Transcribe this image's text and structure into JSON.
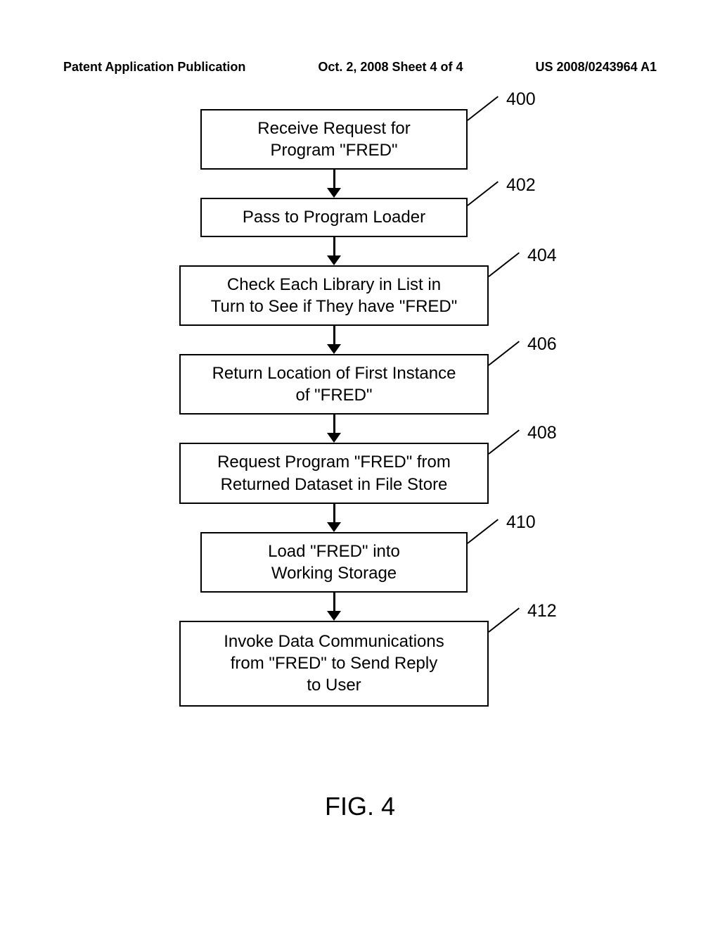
{
  "header": {
    "left": "Patent Application Publication",
    "center": "Oct. 2, 2008  Sheet 4 of 4",
    "right": "US 2008/0243964 A1"
  },
  "steps": [
    {
      "label": "400",
      "line1": "Receive Request for",
      "line2": "Program \"FRED\""
    },
    {
      "label": "402",
      "line1": "Pass to Program Loader",
      "line2": ""
    },
    {
      "label": "404",
      "line1": "Check Each Library in List in",
      "line2": "Turn to See if They have \"FRED\""
    },
    {
      "label": "406",
      "line1": "Return Location of First Instance",
      "line2": "of \"FRED\""
    },
    {
      "label": "408",
      "line1": "Request Program \"FRED\" from",
      "line2": "Returned Dataset in File Store"
    },
    {
      "label": "410",
      "line1": "Load \"FRED\" into",
      "line2": "Working Storage"
    },
    {
      "label": "412",
      "line1": "Invoke Data Communications",
      "line2": "from \"FRED\" to Send Reply",
      "line3": "to User"
    }
  ],
  "figure": "FIG. 4"
}
